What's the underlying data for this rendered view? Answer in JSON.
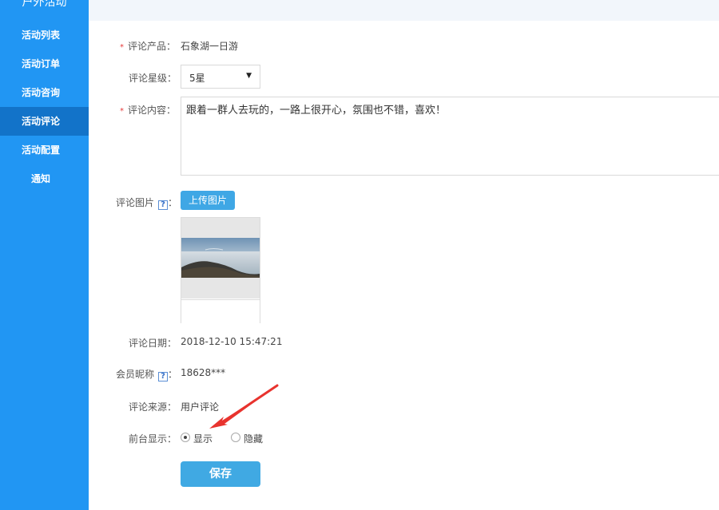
{
  "sidebar": {
    "title": "户外活动",
    "items": [
      {
        "label": "活动列表",
        "active": false
      },
      {
        "label": "活动订单",
        "active": false
      },
      {
        "label": "活动咨询",
        "active": false
      },
      {
        "label": "活动评论",
        "active": true
      },
      {
        "label": "活动配置",
        "active": false
      },
      {
        "label": "通知",
        "active": false
      }
    ]
  },
  "form": {
    "product": {
      "label": "评论产品：",
      "value": "石象湖一日游"
    },
    "rating": {
      "label": "评论星级：",
      "selected": "5星"
    },
    "content": {
      "label": "评论内容：",
      "value": "跟着一群人去玩的，一路上很开心，氛围也不错，喜欢！"
    },
    "images": {
      "label": "评论图片",
      "help": "?",
      "colon": "：",
      "upload_label": "上传图片"
    },
    "date": {
      "label": "评论日期：",
      "value": "2018-12-10 15:47:21"
    },
    "member": {
      "label": "会员昵称",
      "help": "?",
      "colon": "：",
      "value": "18628***"
    },
    "source": {
      "label": "评论来源：",
      "value": "用户评论"
    },
    "display": {
      "label": "前台显示：",
      "options": [
        {
          "label": "显示",
          "checked": true
        },
        {
          "label": "隐藏",
          "checked": false
        }
      ]
    },
    "required_mark": "*",
    "save_label": "保存"
  },
  "colors": {
    "sidebar_bg": "#2196f3",
    "sidebar_active": "#1273c9",
    "button": "#40a9e3",
    "annotation_arrow": "#e8332e"
  },
  "icons": {
    "select_caret": "▼"
  }
}
